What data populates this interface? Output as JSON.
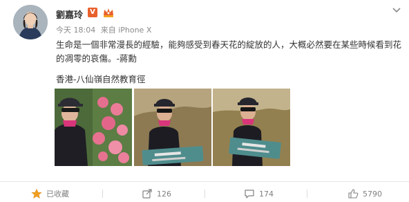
{
  "user": {
    "name": "劉嘉玲",
    "badge_text": "V"
  },
  "meta": {
    "time": "今天 18:04",
    "source": "来自 iPhone X"
  },
  "post": {
    "text": "生命是一個非常漫長的經驗，能夠感受到春天花的綻放的人，大概必然要在某些時候看到花的凋零的哀傷。-蔣勳",
    "location": "香港-八仙嶺自然教育徑"
  },
  "photos": [
    {
      "icon": "photo-azalea-selfie"
    },
    {
      "icon": "photo-trail-sign"
    },
    {
      "icon": "photo-trail-sign-2"
    }
  ],
  "actions": {
    "favorite_label": "已收藏",
    "repost_count": "126",
    "comment_count": "174",
    "like_count": "5790"
  },
  "colors": {
    "accent_orange": "#e8602c",
    "icon_gray": "#808080",
    "favorite_gold": "#f0a020"
  }
}
